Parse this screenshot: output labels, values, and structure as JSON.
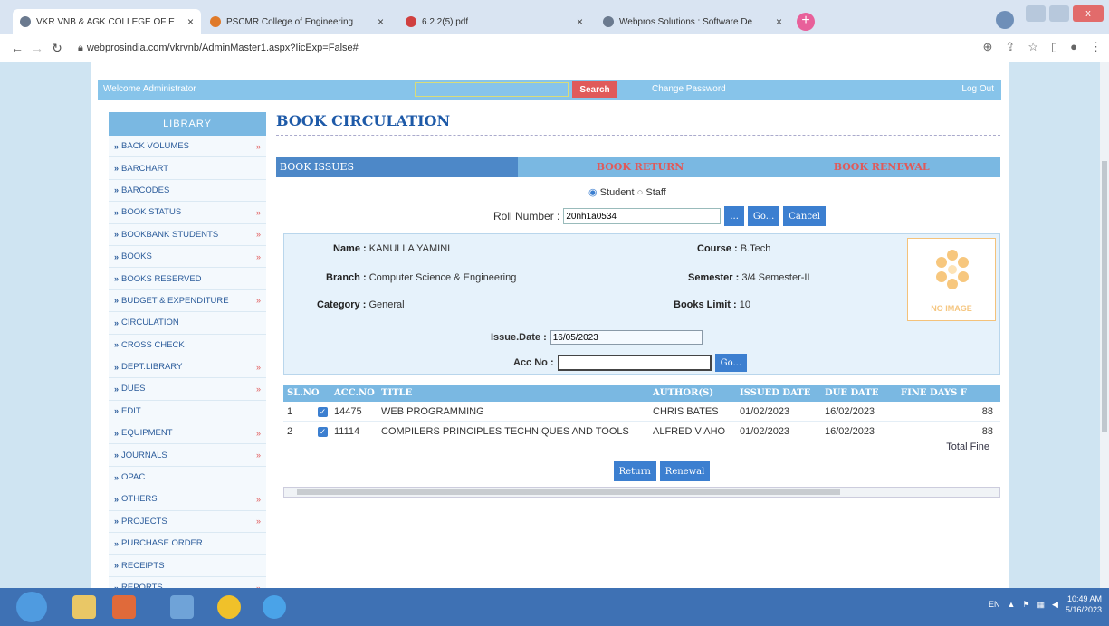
{
  "browser": {
    "tabs": [
      {
        "title": "VKR VNB & AGK COLLEGE OF E",
        "active": true,
        "fav_color": "#6b7a8f"
      },
      {
        "title": "PSCMR College of Engineering",
        "active": false,
        "fav_color": "#e07a2a"
      },
      {
        "title": "6.2.2(5).pdf",
        "active": false,
        "fav_color": "#d04040"
      },
      {
        "title": "Webpros Solutions : Software De",
        "active": false,
        "fav_color": "#6b7a8f"
      }
    ],
    "url": "webprosindia.com/vkrvnb/AdminMaster1.aspx?IicExp=False#"
  },
  "header": {
    "welcome": "Welcome Administrator",
    "search_label": "Search",
    "change_password": "Change Password",
    "logout": "Log Out"
  },
  "sidebar": {
    "title": "LIBRARY",
    "items": [
      {
        "label": "BACK VOLUMES",
        "arrow": true
      },
      {
        "label": "BARCHART",
        "arrow": false
      },
      {
        "label": "BARCODES",
        "arrow": false
      },
      {
        "label": "BOOK STATUS",
        "arrow": true
      },
      {
        "label": "BOOKBANK STUDENTS",
        "arrow": true
      },
      {
        "label": "BOOKS",
        "arrow": true
      },
      {
        "label": "BOOKS RESERVED",
        "arrow": false
      },
      {
        "label": "BUDGET & EXPENDITURE",
        "arrow": true
      },
      {
        "label": "CIRCULATION",
        "arrow": false
      },
      {
        "label": "CROSS CHECK",
        "arrow": false
      },
      {
        "label": "DEPT.LIBRARY",
        "arrow": true
      },
      {
        "label": "DUES",
        "arrow": true
      },
      {
        "label": "EDIT",
        "arrow": false
      },
      {
        "label": "EQUIPMENT",
        "arrow": true
      },
      {
        "label": "JOURNALS",
        "arrow": true
      },
      {
        "label": "OPAC",
        "arrow": false
      },
      {
        "label": "OTHERS",
        "arrow": true
      },
      {
        "label": "PROJECTS",
        "arrow": true
      },
      {
        "label": "PURCHASE ORDER",
        "arrow": false
      },
      {
        "label": "RECEIPTS",
        "arrow": false
      },
      {
        "label": "REPORTS",
        "arrow": true
      }
    ]
  },
  "main": {
    "title": "BOOK CIRCULATION",
    "tabs": [
      "BOOK ISSUES",
      "BOOK RETURN",
      "BOOK RENEWAL"
    ],
    "student_option": "Student",
    "staff_option": "Staff",
    "roll_label": "Roll Number :",
    "roll_value": "20nh1a0534",
    "browse_label": "...",
    "go_label": "Go...",
    "cancel_label": "Cancel",
    "student": {
      "name_label": "Name :",
      "name": "KANULLA YAMINI",
      "course_label": "Course :",
      "course": "B.Tech",
      "branch_label": "Branch :",
      "branch": "Computer Science & Engineering",
      "semester_label": "Semester :",
      "semester": "3/4 Semester-II",
      "category_label": "Category :",
      "category": "General",
      "limit_label": "Books Limit :",
      "limit": "10",
      "no_image": "NO IMAGE"
    },
    "issue_date_label": "Issue.Date :",
    "issue_date": "16/05/2023",
    "acc_label": "Acc No :",
    "acc_go": "Go...",
    "table": {
      "headers": [
        "SL.NO",
        "ACC.NO",
        "TITLE",
        "AUTHOR(S)",
        "ISSUED DATE",
        "DUE DATE",
        "FINE DAYS F"
      ],
      "rows": [
        {
          "sl": "1",
          "acc": "14475",
          "title": "WEB PROGRAMMING",
          "author": "CHRIS BATES",
          "issued": "01/02/2023",
          "due": "16/02/2023",
          "fine_days": "88"
        },
        {
          "sl": "2",
          "acc": "11114",
          "title": "COMPILERS PRINCIPLES TECHNIQUES AND TOOLS",
          "author": "ALFRED V AHO",
          "issued": "01/02/2023",
          "due": "16/02/2023",
          "fine_days": "88"
        }
      ],
      "total_fine_label": "Total Fine"
    },
    "return_label": "Return",
    "renewal_label": "Renewal"
  },
  "taskbar": {
    "lang": "EN",
    "time": "10:49 AM",
    "date": "5/16/2023"
  }
}
